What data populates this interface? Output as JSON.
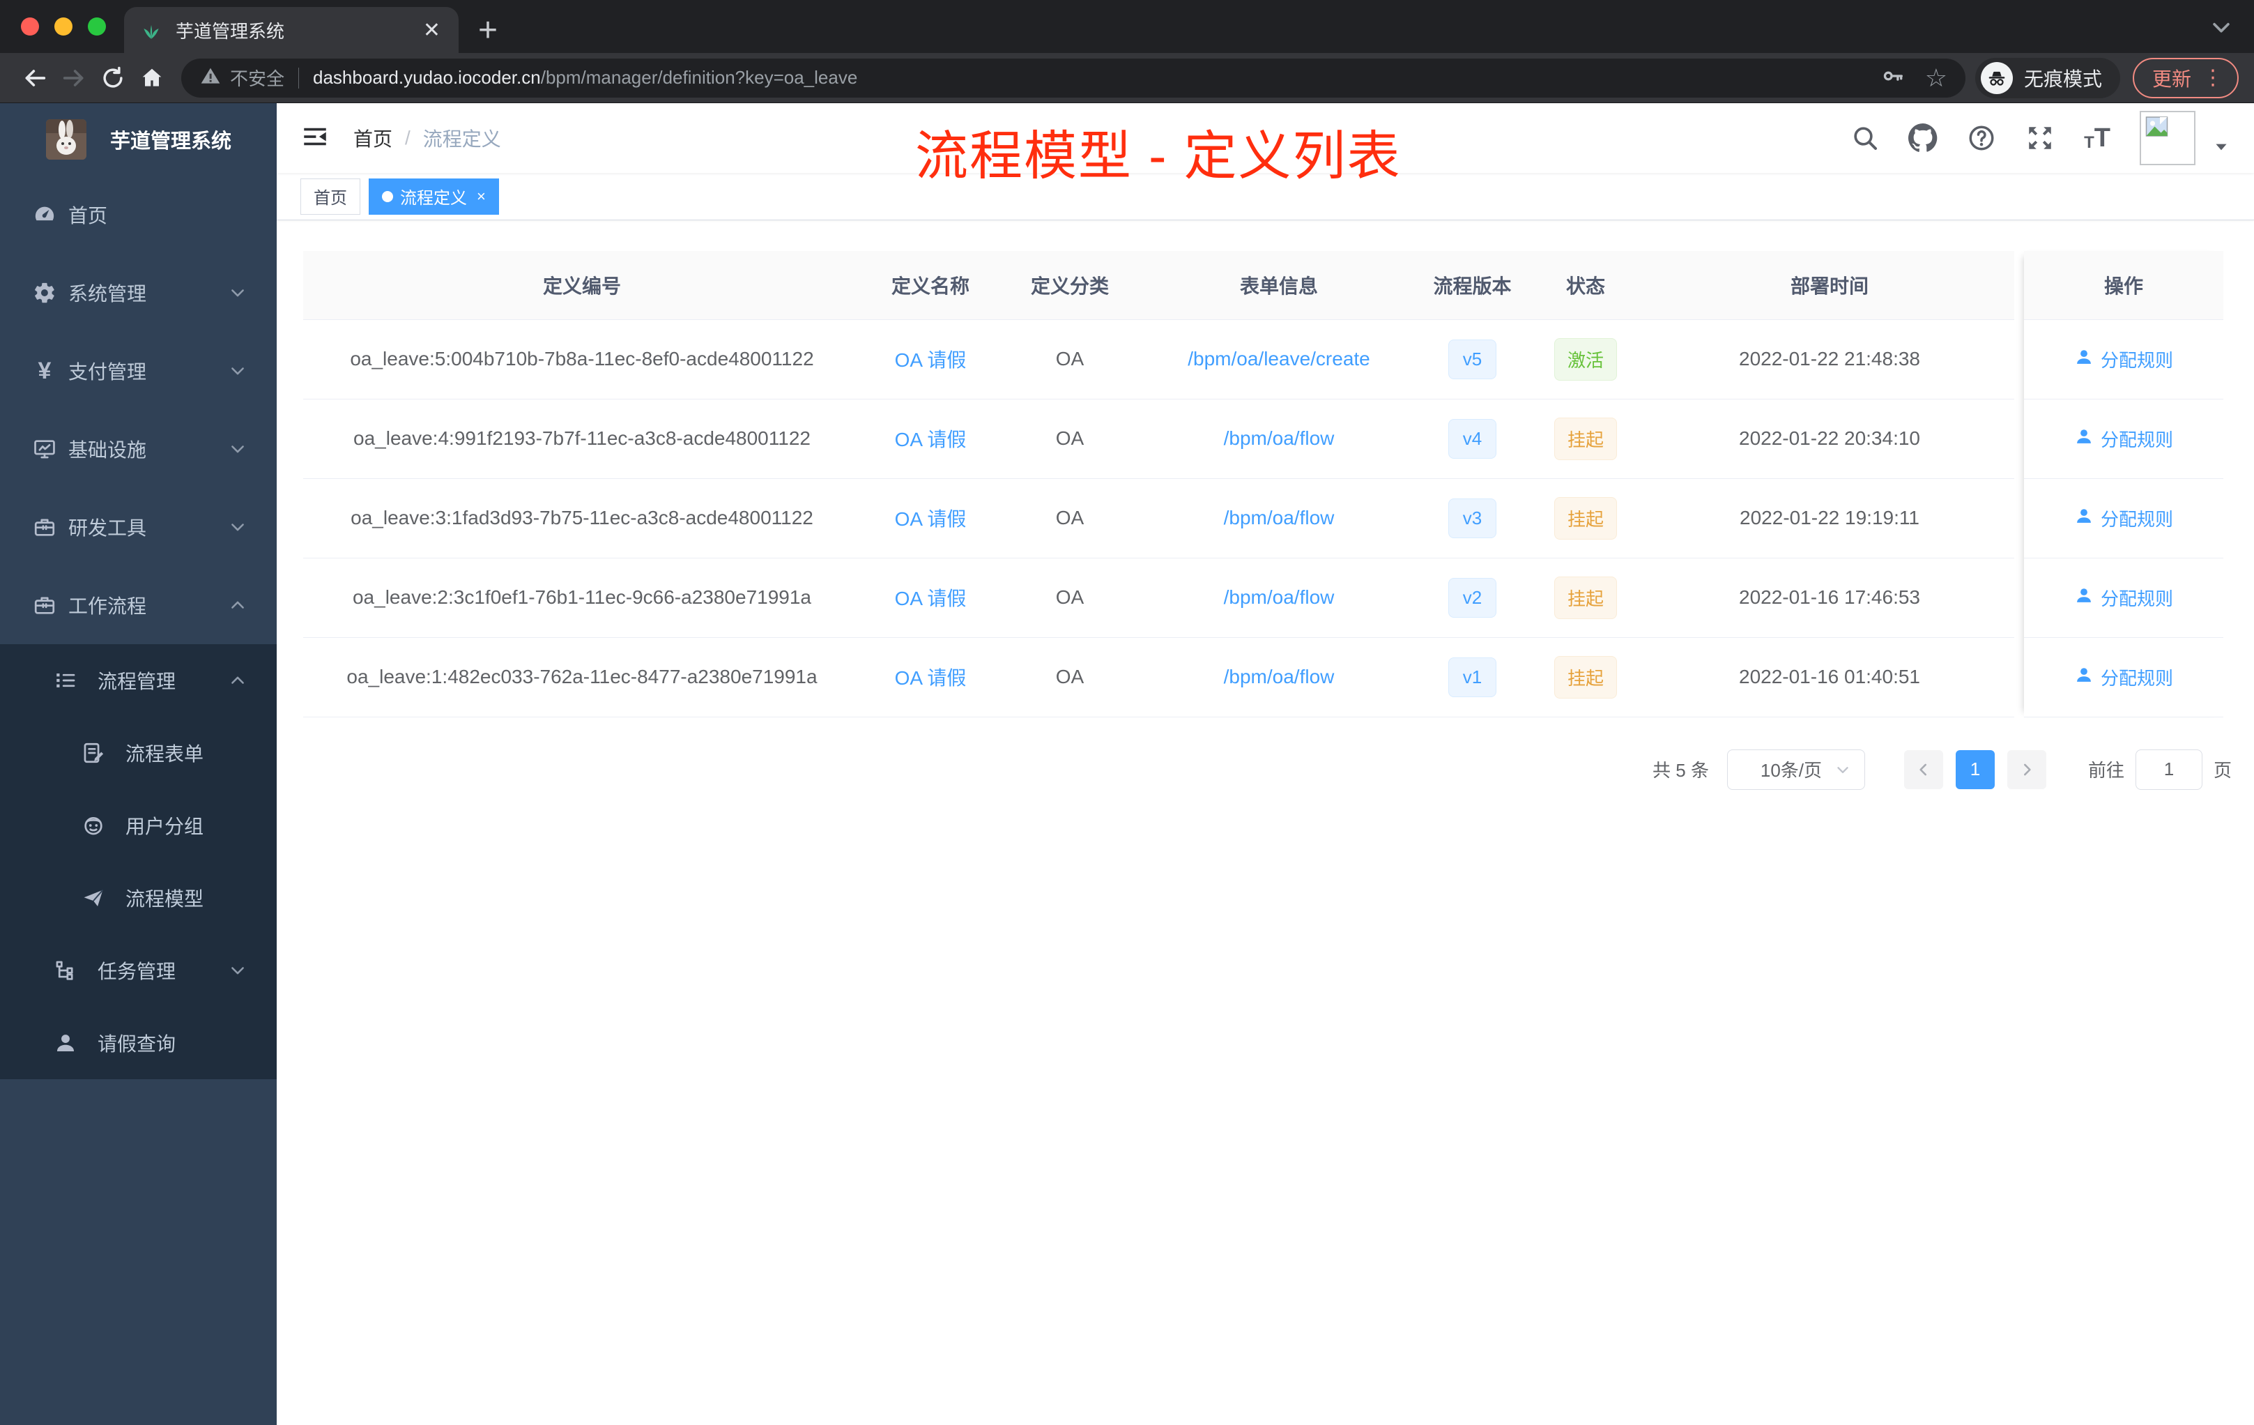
{
  "browser": {
    "tab_title": "芋道管理系统",
    "security_label": "不安全",
    "url_host": "dashboard.yudao.iocoder.cn",
    "url_path": "/bpm/manager/definition?key=oa_leave",
    "incognito_label": "无痕模式",
    "update_label": "更新",
    "nav_icons": [
      "back-icon",
      "forward-icon",
      "reload-icon",
      "home-icon",
      "key-icon",
      "star-icon"
    ]
  },
  "sidebar": {
    "app_title": "芋道管理系统",
    "items": [
      {
        "key": "home",
        "label": "首页",
        "icon": "dashboard-icon",
        "level": 1,
        "arrow": null,
        "dark": false
      },
      {
        "key": "system",
        "label": "系统管理",
        "icon": "gear-icon",
        "level": 1,
        "arrow": "down",
        "dark": false
      },
      {
        "key": "payment",
        "label": "支付管理",
        "icon": "yen-icon",
        "level": 1,
        "arrow": "down",
        "dark": false
      },
      {
        "key": "infra",
        "label": "基础设施",
        "icon": "monitor-icon",
        "level": 1,
        "arrow": "down",
        "dark": false
      },
      {
        "key": "devtools",
        "label": "研发工具",
        "icon": "briefcase-icon",
        "level": 1,
        "arrow": "down",
        "dark": false
      },
      {
        "key": "workflow",
        "label": "工作流程",
        "icon": "briefcase-icon",
        "level": 1,
        "arrow": "up",
        "dark": false
      },
      {
        "key": "process-mgmt",
        "label": "流程管理",
        "icon": "tree-list-icon",
        "level": 2,
        "arrow": "up",
        "dark": true
      },
      {
        "key": "process-form",
        "label": "流程表单",
        "icon": "form-icon",
        "level": 3,
        "arrow": null,
        "dark": true
      },
      {
        "key": "user-group",
        "label": "用户分组",
        "icon": "robot-icon",
        "level": 3,
        "arrow": null,
        "dark": true
      },
      {
        "key": "process-model",
        "label": "流程模型",
        "icon": "send-icon",
        "level": 3,
        "arrow": null,
        "dark": true
      },
      {
        "key": "task-mgmt",
        "label": "任务管理",
        "icon": "tree-icon",
        "level": 2,
        "arrow": "down",
        "dark": true
      },
      {
        "key": "leave-query",
        "label": "请假查询",
        "icon": "user-icon",
        "level": 2,
        "arrow": null,
        "dark": true
      }
    ]
  },
  "navbar": {
    "breadcrumb": {
      "home": "首页",
      "separator": "/",
      "current": "流程定义"
    },
    "icons": [
      "search-icon",
      "github-icon",
      "help-icon",
      "fullscreen-icon",
      "font-size-icon"
    ]
  },
  "annotation": {
    "text": "流程模型 - 定义列表",
    "color": "#ff2e0e"
  },
  "tags": [
    {
      "label": "首页",
      "active": false,
      "closable": false
    },
    {
      "label": "流程定义",
      "active": true,
      "closable": true
    }
  ],
  "table": {
    "columns": [
      "定义编号",
      "定义名称",
      "定义分类",
      "表单信息",
      "流程版本",
      "状态",
      "部署时间",
      "操作"
    ],
    "rows": [
      {
        "id": "oa_leave:5:004b710b-7b8a-11ec-8ef0-acde48001122",
        "name": "OA 请假",
        "category": "OA",
        "form": "/bpm/oa/leave/create",
        "version": "v5",
        "status": "激活",
        "status_type": "success",
        "deployed_at": "2022-01-22 21:48:38",
        "action": "分配规则"
      },
      {
        "id": "oa_leave:4:991f2193-7b7f-11ec-a3c8-acde48001122",
        "name": "OA 请假",
        "category": "OA",
        "form": "/bpm/oa/flow",
        "version": "v4",
        "status": "挂起",
        "status_type": "warning",
        "deployed_at": "2022-01-22 20:34:10",
        "action": "分配规则"
      },
      {
        "id": "oa_leave:3:1fad3d93-7b75-11ec-a3c8-acde48001122",
        "name": "OA 请假",
        "category": "OA",
        "form": "/bpm/oa/flow",
        "version": "v3",
        "status": "挂起",
        "status_type": "warning",
        "deployed_at": "2022-01-22 19:19:11",
        "action": "分配规则"
      },
      {
        "id": "oa_leave:2:3c1f0ef1-76b1-11ec-9c66-a2380e71991a",
        "name": "OA 请假",
        "category": "OA",
        "form": "/bpm/oa/flow",
        "version": "v2",
        "status": "挂起",
        "status_type": "warning",
        "deployed_at": "2022-01-16 17:46:53",
        "action": "分配规则"
      },
      {
        "id": "oa_leave:1:482ec033-762a-11ec-8477-a2380e71991a",
        "name": "OA 请假",
        "category": "OA",
        "form": "/bpm/oa/flow",
        "version": "v1",
        "status": "挂起",
        "status_type": "warning",
        "deployed_at": "2022-01-16 01:40:51",
        "action": "分配规则"
      }
    ]
  },
  "pagination": {
    "total_label": "共 5 条",
    "page_size_label": "10条/页",
    "current_page": "1",
    "goto_label": "前往",
    "goto_value": "1",
    "page_suffix": "页"
  },
  "colors": {
    "accent_blue": "#409eff",
    "sidebar_bg": "#304156",
    "sidebar_submenu_bg": "#1f2d3d",
    "status_active_green": "#67c23a",
    "status_suspend_orange": "#e6a23c",
    "annotation_red": "#ff2e0e",
    "chrome_update_red": "#f28b82"
  }
}
